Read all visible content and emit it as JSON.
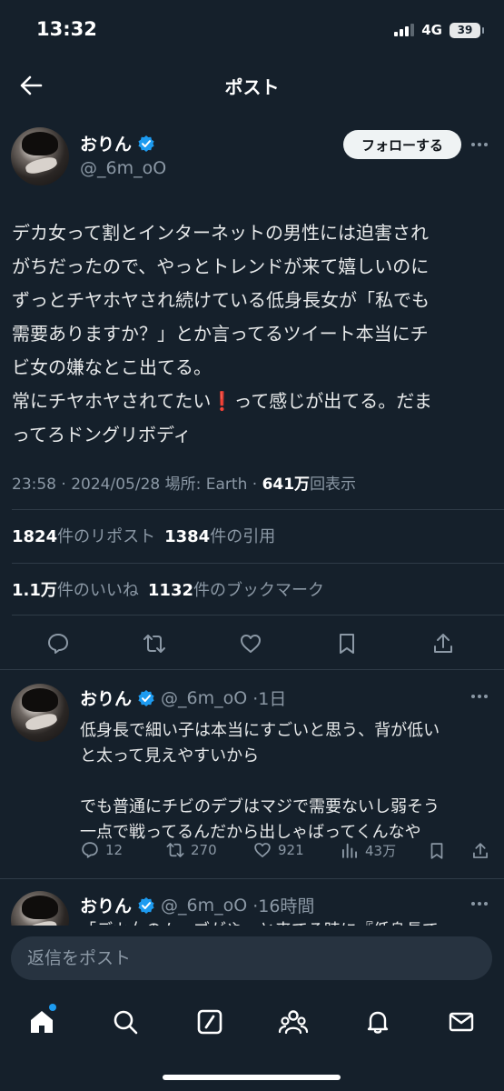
{
  "status_bar": {
    "time": "13:32",
    "network": "4G",
    "battery": "39"
  },
  "header": {
    "title": "ポスト"
  },
  "post": {
    "author_name": "おりん",
    "handle": "@_6m_oO",
    "follow_label": "フォローする",
    "text_lines": [
      "デカ女って割とインターネットの男性には迫害され",
      "がちだったので、やっとトレンドが来て嬉しいのに",
      "ずっとチヤホヤされ続けている低身長女が「私でも",
      "需要ありますか？」とか言ってるツイート本当にチ",
      "ビ女の嫌なとこ出てる。",
      "常にチヤホヤされてたい",
      "❗",
      "って感じが出てる。だま",
      "ってろドングリボディ"
    ],
    "time": "23:58",
    "date": "2024/05/28",
    "location_prefix": "場所:",
    "location": "Earth",
    "views": "641万",
    "views_label": "回表示",
    "reposts": "1824",
    "reposts_label": "件のリポスト",
    "quotes": "1384",
    "quotes_label": "件の引用",
    "likes": "1.1万",
    "likes_label": "件のいいね",
    "bookmarks": "1132",
    "bookmarks_label": "件のブックマーク"
  },
  "replies": [
    {
      "name": "おりん",
      "handle": "@_6m_oO",
      "time": "·1日",
      "lines": [
        "低身長で細い子は本当にすごいと思う、背が低い",
        "と太って見えやすいから",
        "",
        "でも普通にチビのデブはマジで需要ないし弱そう",
        "一点で戦ってるんだから出しゃばってくんなや"
      ],
      "replies": "12",
      "reposts": "270",
      "likes": "921",
      "views": "43万"
    },
    {
      "name": "おりん",
      "handle": "@_6m_oO",
      "time": "·16時間",
      "lines": [
        "「デカ女のムーブがやっと来てる時に『低身長で"
      ]
    }
  ],
  "composer": {
    "placeholder": "返信をポスト"
  },
  "colors": {
    "background": "#15202b",
    "accent": "#1d9bf0",
    "muted": "#8b98a5"
  }
}
